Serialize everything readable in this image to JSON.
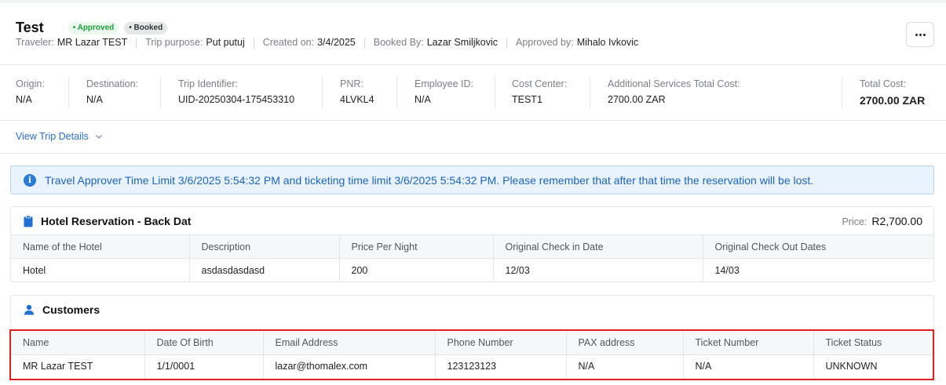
{
  "header": {
    "title": "Test",
    "badge_approved": "• Approved",
    "badge_booked": "• Booked",
    "meta": [
      {
        "label": "Traveler:",
        "value": "MR Lazar TEST"
      },
      {
        "label": "Trip purpose:",
        "value": "Put putuj"
      },
      {
        "label": "Created on:",
        "value": "3/4/2025"
      },
      {
        "label": "Booked By:",
        "value": "Lazar Smiljkovic"
      },
      {
        "label": "Approved by:",
        "value": "Mihalo Ivkovic"
      }
    ],
    "more_icon": "ellipsis-icon"
  },
  "summary": {
    "origin": {
      "label": "Origin:",
      "value": "N/A"
    },
    "destination": {
      "label": "Destination:",
      "value": "N/A"
    },
    "trip_id": {
      "label": "Trip Identifier:",
      "value": "UID-20250304-175453310"
    },
    "pnr": {
      "label": "PNR:",
      "value": "4LVKL4"
    },
    "employee_id": {
      "label": "Employee ID:",
      "value": "N/A"
    },
    "cost_center": {
      "label": "Cost Center:",
      "value": "TEST1"
    },
    "additional_cost": {
      "label": "Additional Services Total Cost:",
      "value": "2700.00 ZAR"
    },
    "total_cost": {
      "label": "Total Cost:",
      "value": "2700.00 ZAR"
    }
  },
  "view_details": "View Trip Details",
  "alert": {
    "text": "Travel Approver Time Limit 3/6/2025 5:54:32 PM and ticketing time limit 3/6/2025 5:54:32 PM. Please remember that after that time the reservation will be lost.",
    "icon": "info-icon",
    "color": "#1d64b8"
  },
  "hotel": {
    "title": "Hotel Reservation - Back Dat",
    "price_label": "Price:",
    "price_value": "R2,700.00",
    "columns": [
      "Name of the Hotel",
      "Description",
      "Price Per Night",
      "Original Check in Date",
      "Original Check Out Dates"
    ],
    "row": [
      "Hotel",
      "asdasdasdasd",
      "200",
      "12/03",
      "14/03"
    ]
  },
  "customers": {
    "title": "Customers",
    "columns": [
      "Name",
      "Date Of Birth",
      "Email Address",
      "Phone Number",
      "PAX address",
      "Ticket Number",
      "Ticket Status"
    ],
    "row": [
      "MR Lazar TEST",
      "1/1/0001",
      "lazar@thomalex.com",
      "123123123",
      "N/A",
      "N/A",
      "UNKNOWN"
    ],
    "highlight_color": "#e02020"
  }
}
